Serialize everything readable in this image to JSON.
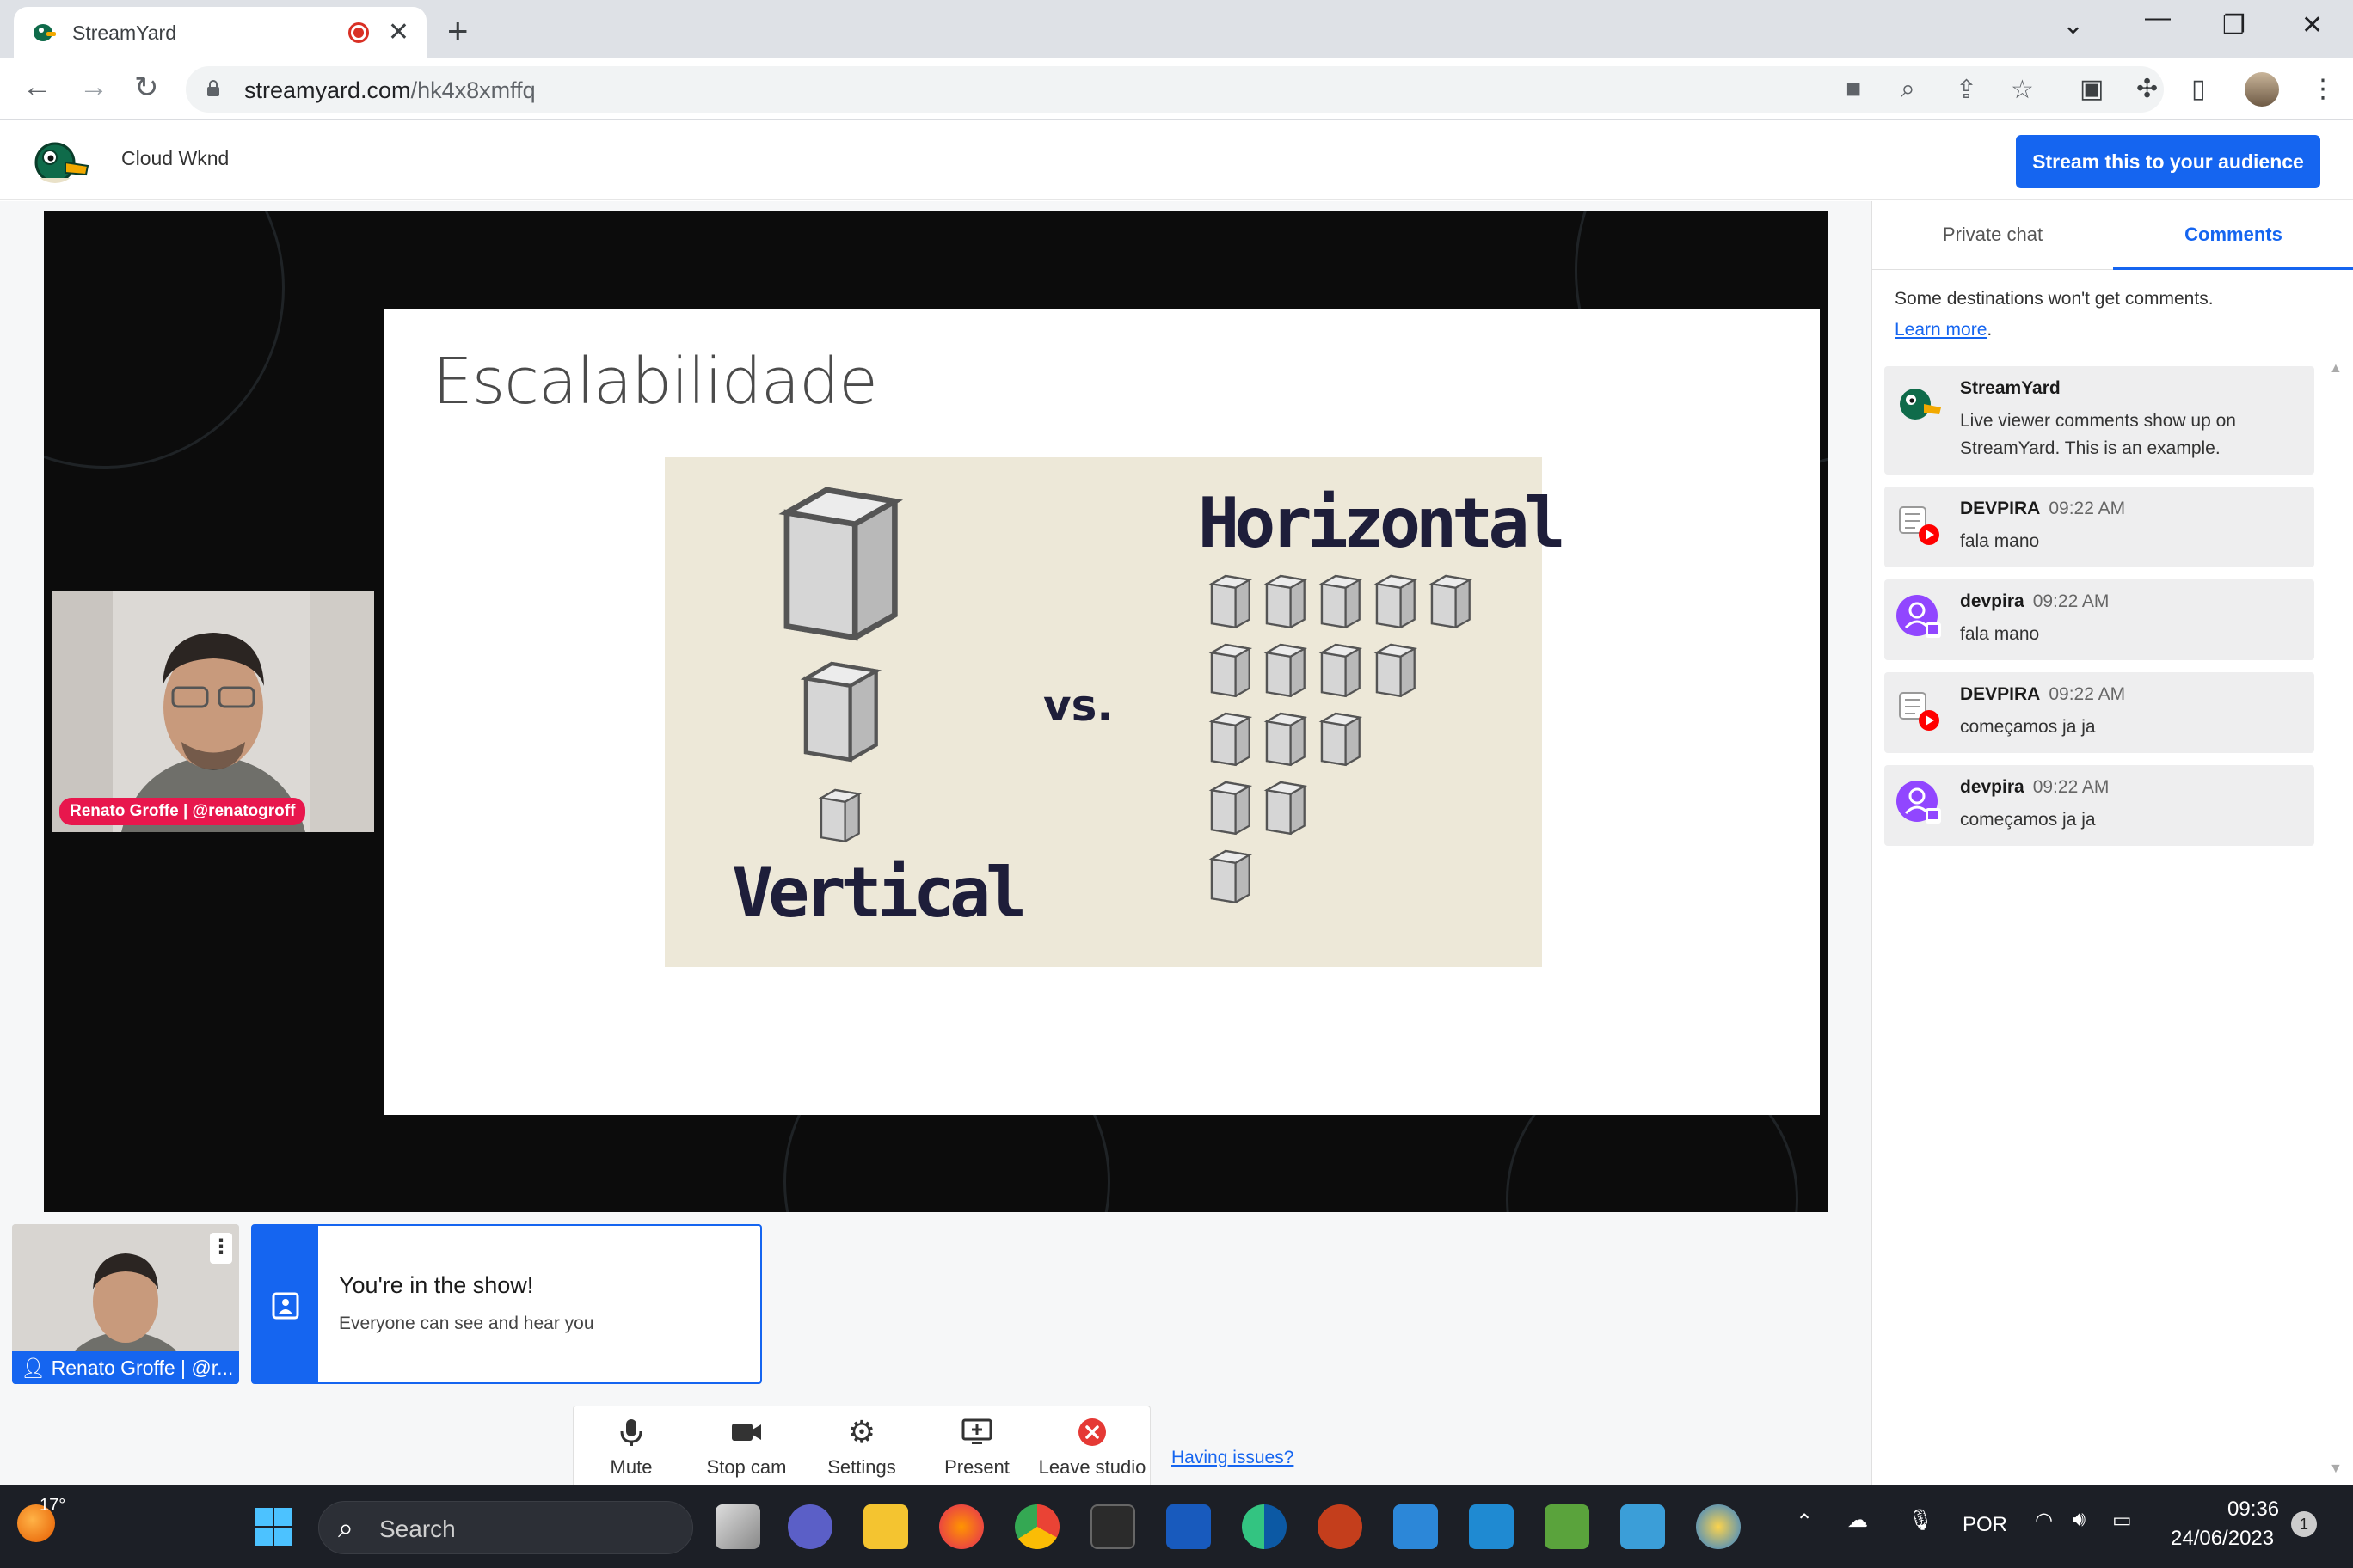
{
  "browser": {
    "tab_title": "StreamYard",
    "url_host": "streamyard.com",
    "url_path": "/hk4x8xmffq"
  },
  "header": {
    "studio_name": "Cloud Wknd",
    "stream_button": "Stream this to your audience"
  },
  "slide": {
    "title": "Escalabilidade",
    "vertical_label": "Vertical",
    "horizontal_label": "Horizontal",
    "vs_label": "vs."
  },
  "camera": {
    "name_tag": "Renato Groffe | @renatogroff"
  },
  "thumbnail": {
    "name": "Renato Groffe | @r..."
  },
  "show_card": {
    "title": "You're in the show!",
    "subtitle": "Everyone can see and hear you"
  },
  "controls": {
    "mute": "Mute",
    "stop_cam": "Stop cam",
    "settings": "Settings",
    "present": "Present",
    "leave": "Leave studio",
    "having_issues": "Having issues?"
  },
  "panel": {
    "tab_private": "Private chat",
    "tab_comments": "Comments",
    "notice": "Some destinations won't get comments.",
    "learn_more": "Learn more",
    "comments": [
      {
        "name": "StreamYard",
        "time": "",
        "text": "Live viewer comments show up on StreamYard. This is an example.",
        "source": "streamyard"
      },
      {
        "name": "DEVPIRA",
        "time": "09:22 AM",
        "text": "fala mano",
        "source": "youtube"
      },
      {
        "name": "devpira",
        "time": "09:22 AM",
        "text": "fala mano",
        "source": "twitch"
      },
      {
        "name": "DEVPIRA",
        "time": "09:22 AM",
        "text": "começamos ja ja",
        "source": "youtube"
      },
      {
        "name": "devpira",
        "time": "09:22 AM",
        "text": "começamos ja ja",
        "source": "twitch"
      }
    ]
  },
  "taskbar": {
    "temperature": "17°",
    "search": "Search",
    "language": "POR",
    "time": "09:36",
    "date": "24/06/2023",
    "notifications": "1"
  },
  "colors": {
    "accent": "#1565f0",
    "name_tag": "#e8174d",
    "twitch": "#9146ff",
    "youtube": "#ff0000"
  }
}
